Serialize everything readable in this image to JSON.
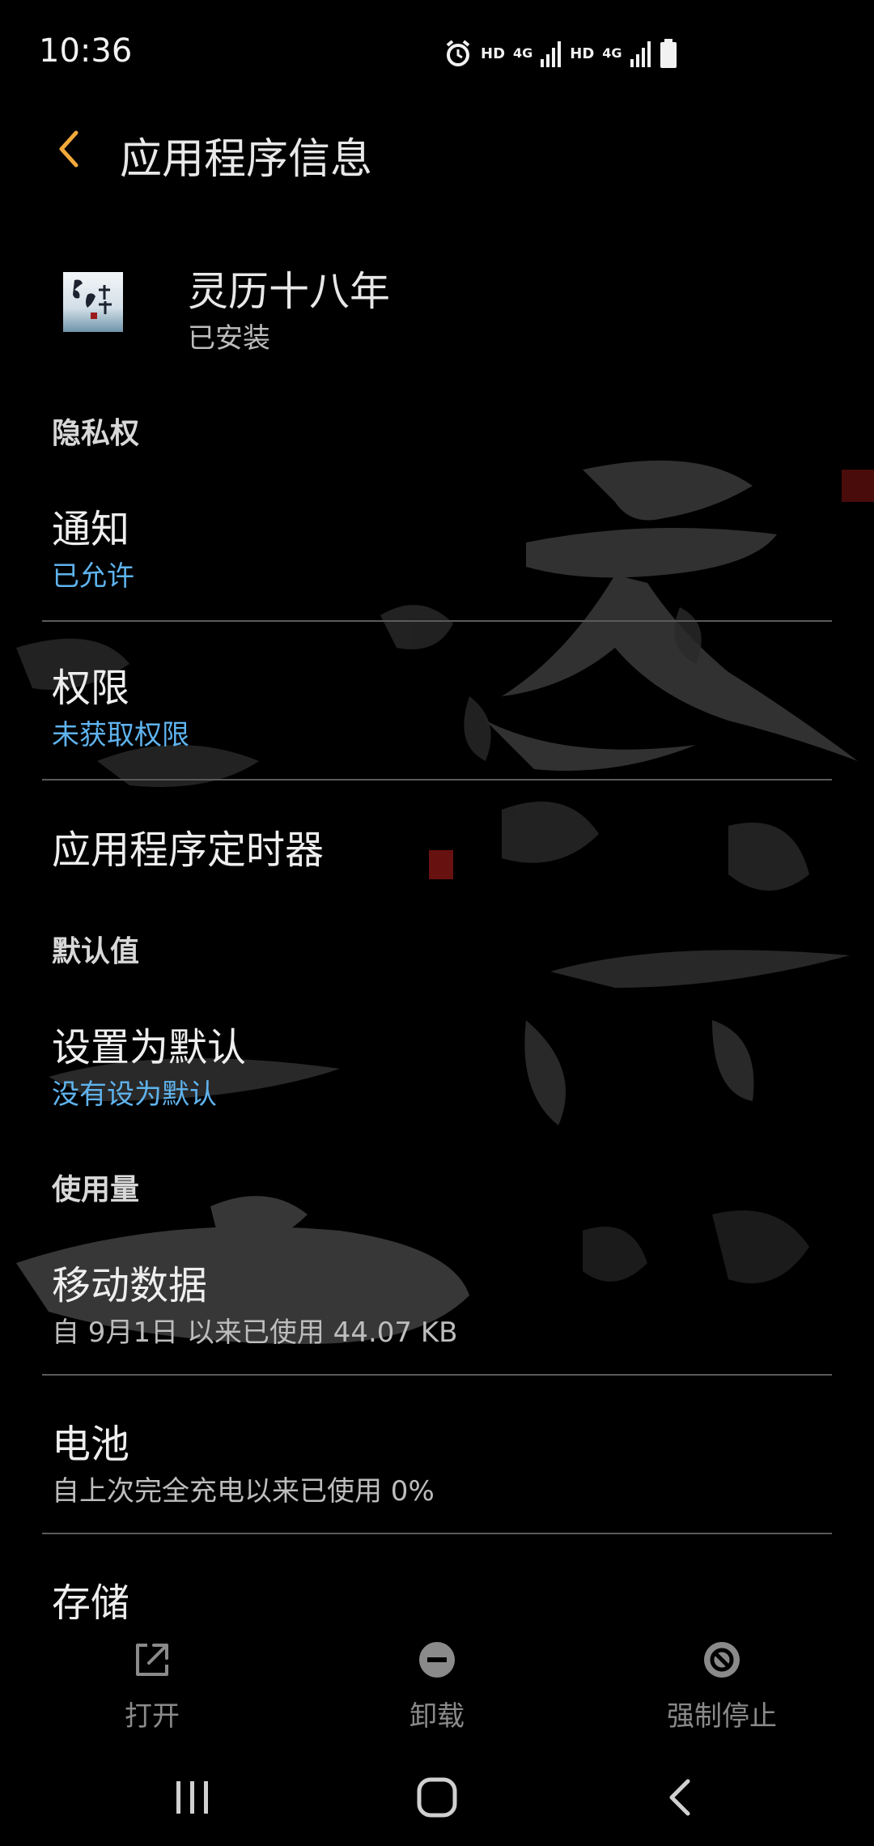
{
  "status_bar": {
    "time": "10:36",
    "hd1": "HD",
    "net1": "4G",
    "hd2": "HD",
    "net2": "4G",
    "icons": [
      "alarm-icon",
      "signal-icon",
      "signal-icon",
      "battery-icon"
    ]
  },
  "app_bar": {
    "back_icon": "chevron-left-icon",
    "title": "应用程序信息",
    "accent_color": "#f2a93b"
  },
  "app": {
    "name": "灵历十八年",
    "status": "已安装",
    "icon_text": "灵历十八年"
  },
  "sections": {
    "privacy": {
      "header": "隐私权",
      "notifications": {
        "label": "通知",
        "value": "已允许"
      },
      "permissions": {
        "label": "权限",
        "value": "未获取权限"
      },
      "timer": {
        "label": "应用程序定时器"
      }
    },
    "defaults": {
      "header": "默认值",
      "set_default": {
        "label": "设置为默认",
        "value": "没有设为默认"
      }
    },
    "usage": {
      "header": "使用量",
      "mobile_data": {
        "label": "移动数据",
        "value": "自 9月1日 以来已使用 44.07 KB"
      },
      "battery": {
        "label": "电池",
        "value": "自上次完全充电以来已使用 0%"
      },
      "storage": {
        "label": "存储"
      }
    }
  },
  "actions": {
    "open": {
      "label": "打开",
      "icon": "open-external-icon"
    },
    "uninstall": {
      "label": "卸载",
      "icon": "minus-circle-icon"
    },
    "force_stop": {
      "label": "强制停止",
      "icon": "block-icon"
    }
  },
  "nav": {
    "recents_icon": "recents-icon",
    "home_icon": "home-icon",
    "back_icon": "back-icon"
  },
  "colors": {
    "link_blue": "#5fb3ee",
    "accent": "#f2a93b",
    "text": "#eeeeee",
    "subtle": "#bdbdbd"
  }
}
